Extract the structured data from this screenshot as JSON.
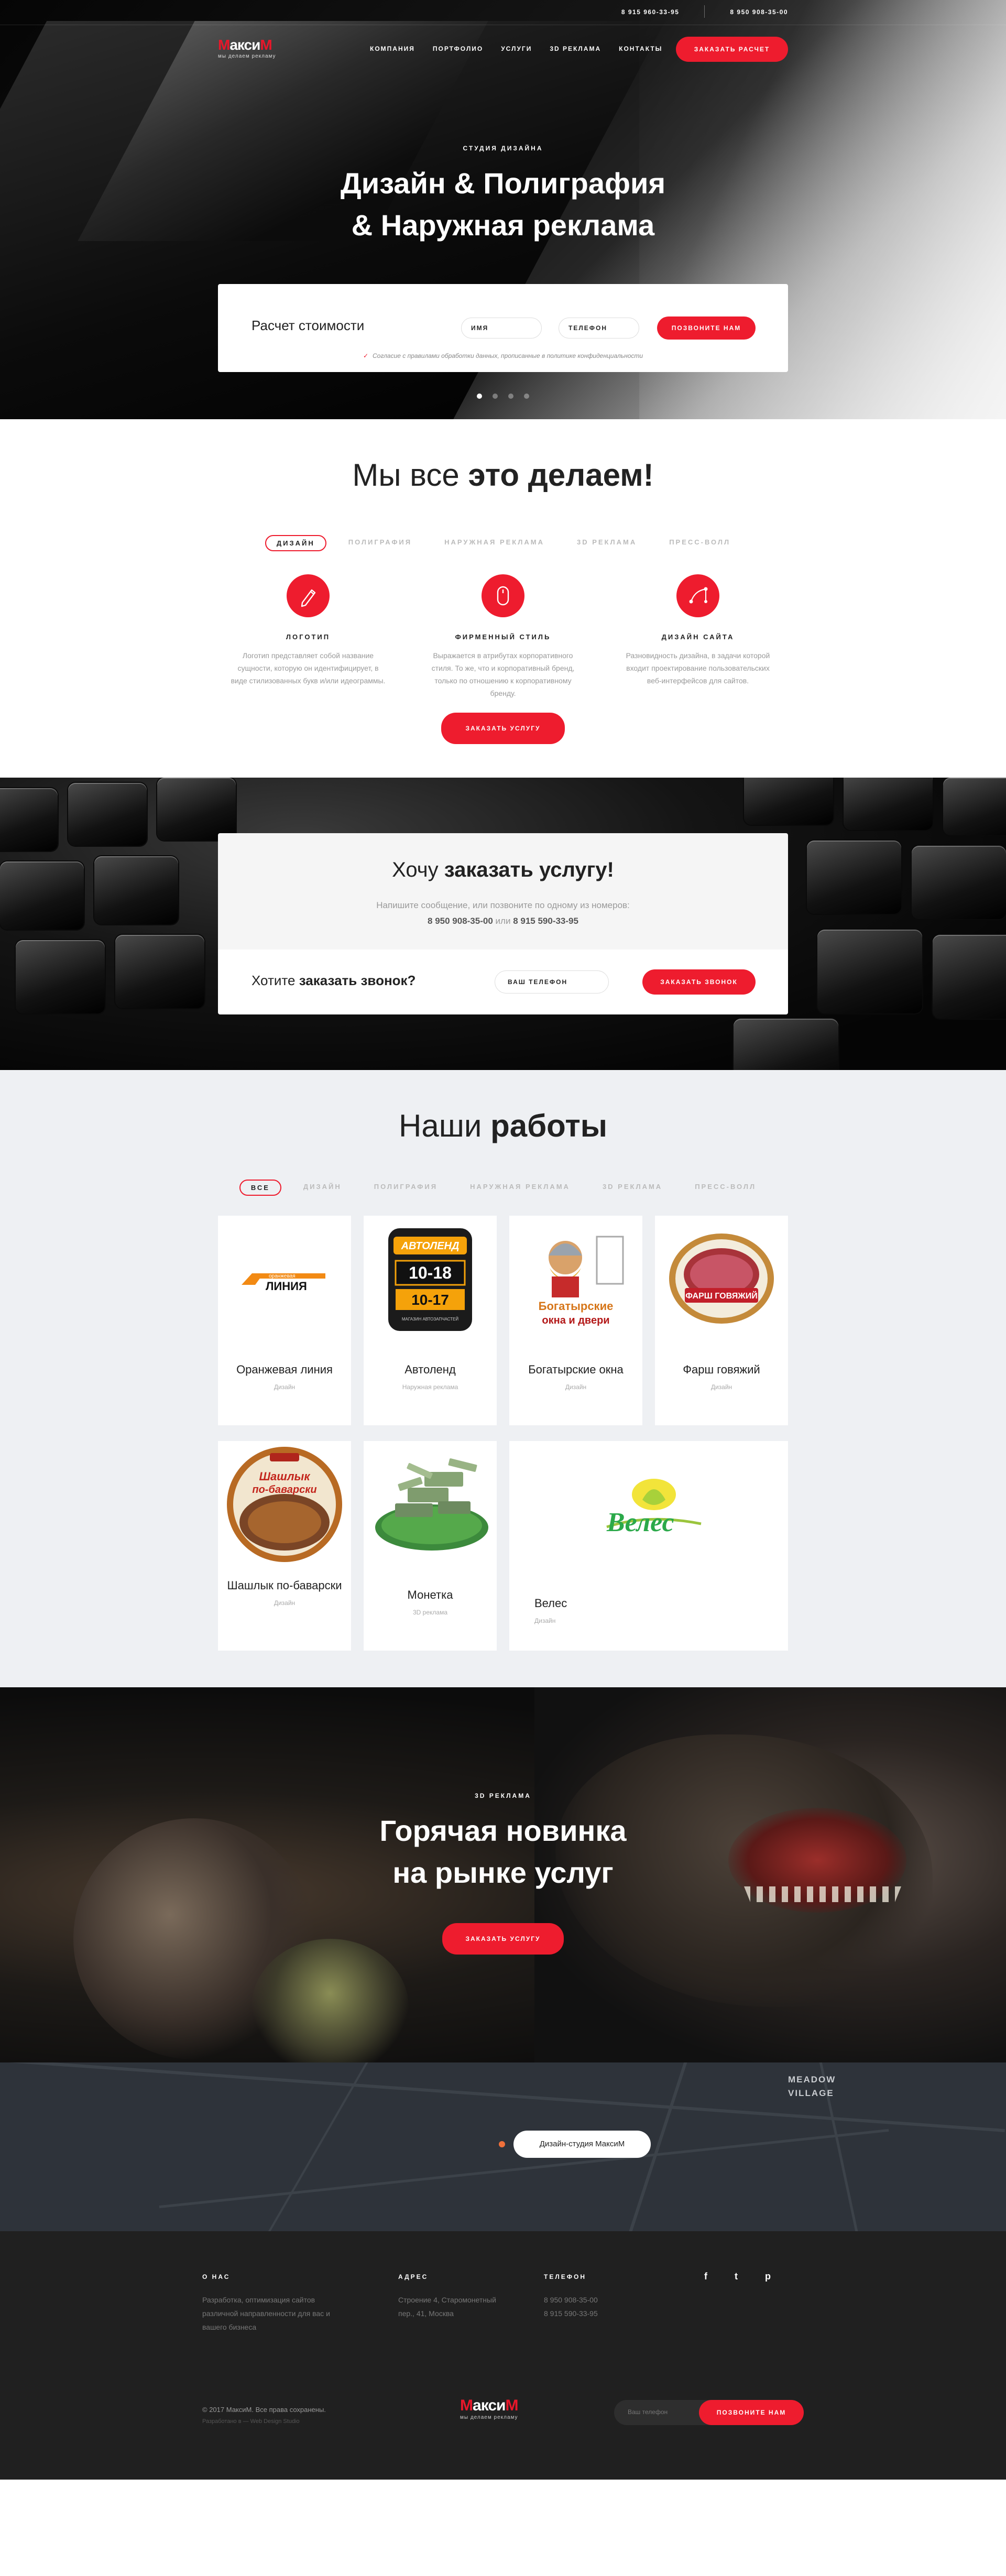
{
  "header": {
    "phones": [
      "8 915 960-33-95",
      "8 950 908-35-00"
    ],
    "logo": {
      "title_red": "М",
      "title_rest": "акси",
      "title_red2": "М",
      "tagline": "мы делаем рекламу"
    },
    "menu": [
      "КОМПАНИЯ",
      "ПОРТФОЛИО",
      "УСЛУГИ",
      "3D РЕКЛАМА",
      "КОНТАКТЫ"
    ],
    "cta": "ЗАКАЗАТЬ РАСЧЕТ"
  },
  "hero": {
    "eyebrow": "СТУДИЯ ДИЗАЙНА",
    "title_line1": "Дизайн & Полиграфия",
    "title_line2": "& Наружная реклама",
    "calc": {
      "title": "Расчет стоимости",
      "name_placeholder": "ИМЯ",
      "phone_placeholder": "ТЕЛЕФОН",
      "button": "ПОЗВОНИТЕ НАМ",
      "note": "Согласие с правилами обработки данных, прописанные в политике конфиденциальности"
    },
    "slides": 4,
    "active_slide": 1
  },
  "services": {
    "title_light": "Мы все",
    "title_bold": "это делаем!",
    "tabs": [
      "ДИЗАЙН",
      "ПОЛИГРАФИЯ",
      "НАРУЖНАЯ РЕКЛАМА",
      "3D РЕКЛАМА",
      "ПРЕСС-ВОЛЛ"
    ],
    "active_tab": 0,
    "items": [
      {
        "icon": "pen-icon",
        "title": "ЛОГОТИП",
        "text": "Логотип представляет собой название сущности, которую он идентифицирует, в виде стилизованных букв и/или идеограммы."
      },
      {
        "icon": "mouse-icon",
        "title": "ФИРМЕННЫЙ СТИЛЬ",
        "text": "Выражается в атрибутах корпоративного стиля. То же, что и корпоративный бренд, только по отношению к корпоративному бренду."
      },
      {
        "icon": "vector-icon",
        "title": "ДИЗАЙН САЙТА",
        "text": "Разновидность дизайна, в задачи которой входит проектирование пользовательских веб-интерфейсов для сайтов."
      }
    ],
    "button": "ЗАКАЗАТЬ УСЛУГУ"
  },
  "order": {
    "title_light": "Хочу",
    "title_bold": "заказать услугу!",
    "text": "Напишите сообщение, или позвоните по одному из номеров:",
    "phone1": "8 950 908-35-00",
    "or": "или",
    "phone2": "8 915 590-33-95",
    "question_light": "Хотите",
    "question_bold": "заказать звонок?",
    "phone_placeholder": "ВАШ ТЕЛЕФОН",
    "button": "ЗАКАЗАТЬ ЗВОНОК"
  },
  "works": {
    "title_light": "Наши",
    "title_bold": "работы",
    "tabs": [
      "ВСЕ",
      "ДИЗАЙН",
      "ПОЛИГРАФИЯ",
      "НАРУЖНАЯ РЕКЛАМА",
      "3D РЕКЛАМА",
      "ПРЕСС-ВОЛЛ"
    ],
    "active_tab": 0,
    "items": [
      {
        "name": "Оранжевая линия",
        "category": "Дизайн",
        "logo_text_top": "оранжевая",
        "logo_text_bottom": "ЛИНИЯ"
      },
      {
        "name": "Автоленд",
        "category": "Наружная реклама",
        "logo_text_top": "АВТОЛЕНД",
        "logo_hours_top": "10-18",
        "logo_hours_bottom": "10-17",
        "logo_caption": "МАГАЗИН АВТОЗАПЧАСТЕЙ"
      },
      {
        "name": "Богатырские окна",
        "category": "Дизайн",
        "logo_text_top": "Богатырские",
        "logo_text_bottom": "окна и двери"
      },
      {
        "name": "Фарш говяжий",
        "category": "Дизайн",
        "logo_text_top": "ФАРШ ГОВЯЖИЙ"
      },
      {
        "name": "Шашлык по-баварски",
        "category": "Дизайн",
        "logo_text_top": "Шашлык",
        "logo_text_bottom": "по-баварски"
      },
      {
        "name": "Монетка",
        "category": "3D реклама"
      },
      {
        "name": "Велес",
        "category": "Дизайн",
        "logo_text_top": "Велес"
      }
    ]
  },
  "three_d": {
    "eyebrow": "3D РЕКЛАМА",
    "title_line1": "Горячая новинка",
    "title_line2": "на рынке услуг",
    "button": "ЗАКАЗАТЬ УСЛУГУ"
  },
  "map": {
    "bubble_prefix": "Дизайн-студия М",
    "bubble_middle": "акси",
    "bubble_suffix": "М",
    "place_line1": "MEADOW",
    "place_line2": "VILLAGE"
  },
  "footer": {
    "about_title": "О НАС",
    "about_text": "Разработка, оптимизация сайтов различной направленности для вас и вашего бизнеса",
    "address_title": "АДРЕС",
    "address_text": "Строение 4, Старомонетный пер., 41, Москва",
    "phone_title": "ТЕЛЕФОН",
    "phones": [
      "8 950 908-35-00",
      "8 915 590-33-95"
    ],
    "social": [
      "f",
      "t",
      "p"
    ],
    "copyright": "© 2017 МаксиМ. Все права сохранены.",
    "copyright_sub": "Разработано в — Web Design Studio",
    "form_placeholder": "Ваш телефон",
    "form_button": "ПОЗВОНИТЕ НАМ"
  },
  "colors": {
    "accent": "#ee1c2e",
    "dark": "#202020",
    "light_bg": "#eef0f3"
  }
}
